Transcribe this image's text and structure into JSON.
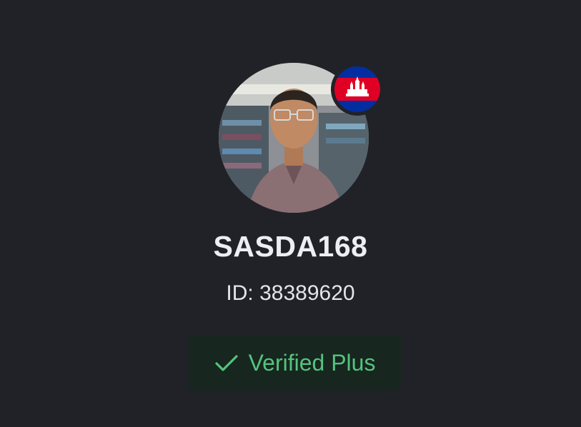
{
  "profile": {
    "username": "SASDA168",
    "id_text": "ID: 38389620",
    "verification_label": "Verified Plus",
    "avatar_icon": "user-photo",
    "country_flag_icon": "cambodia-flag-icon",
    "badge_icon": "checkmark-icon"
  },
  "colors": {
    "background": "#202227",
    "text_primary": "#eceef2",
    "badge_background": "#17261f",
    "badge_accent": "#55c37e",
    "flag_blue": "#032ea1",
    "flag_red": "#e00025"
  }
}
